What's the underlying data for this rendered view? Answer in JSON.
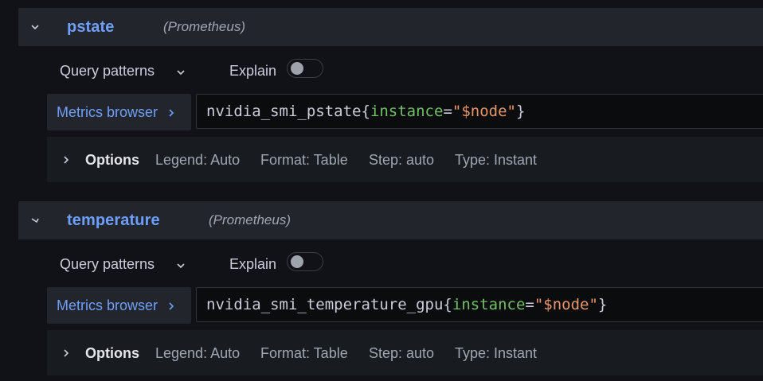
{
  "queries": [
    {
      "name": "pstate",
      "datasource": "(Prometheus)",
      "query_patterns_label": "Query patterns",
      "explain_label": "Explain",
      "explain_on": false,
      "metrics_browser_label": "Metrics browser",
      "expr": {
        "metric": "nvidia_smi_pstate",
        "open_brace": "{",
        "label": "instance",
        "op": "=",
        "value": "\"$node\"",
        "close_brace": "}"
      },
      "options": {
        "title": "Options",
        "legend": "Legend: Auto",
        "format": "Format: Table",
        "step": "Step: auto",
        "type": "Type: Instant"
      }
    },
    {
      "name": "temperature",
      "datasource": "(Prometheus)",
      "query_patterns_label": "Query patterns",
      "explain_label": "Explain",
      "explain_on": false,
      "metrics_browser_label": "Metrics browser",
      "expr": {
        "metric": "nvidia_smi_temperature_gpu",
        "open_brace": "{",
        "label": "instance",
        "op": "=",
        "value": "\"$node\"",
        "close_brace": "}"
      },
      "options": {
        "title": "Options",
        "legend": "Legend: Auto",
        "format": "Format: Table",
        "step": "Step: auto",
        "type": "Type: Instant"
      }
    }
  ],
  "icons": {
    "collapse": "chevron-down-icon",
    "dropdown": "chevron-down-icon",
    "metrics_browser": "chevron-right-icon",
    "options": "chevron-right-icon"
  },
  "colors": {
    "background": "#111217",
    "header_bg": "#22252b",
    "accent_blue": "#6e9fff",
    "label_green": "#73bf69",
    "string_orange": "#e8976b"
  }
}
